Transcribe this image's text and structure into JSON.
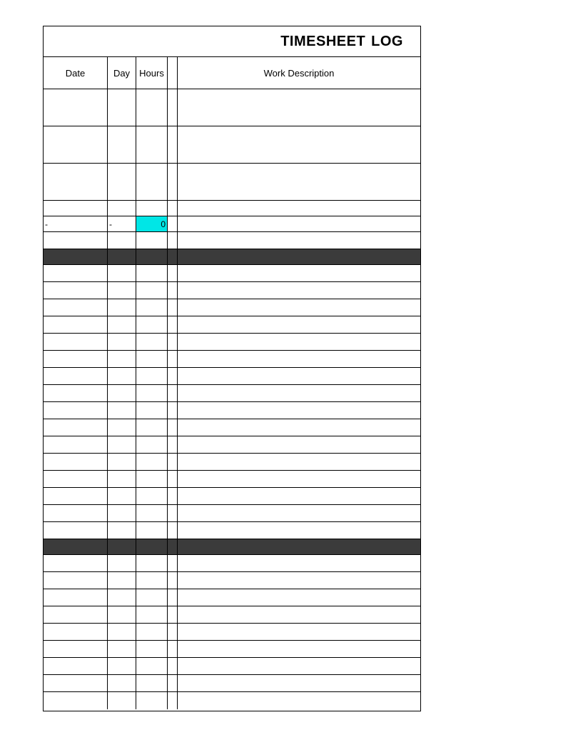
{
  "title": {
    "word1": "TIMESHEET",
    "word2": "LOG"
  },
  "headers": {
    "date": "Date",
    "day": "Day",
    "hours": "Hours",
    "gap": "",
    "desc": "Work Description"
  },
  "section1": {
    "rows": [
      {
        "type": "tall",
        "date": "",
        "day": "",
        "hours": "",
        "desc": ""
      },
      {
        "type": "tall",
        "date": "",
        "day": "",
        "hours": "",
        "desc": ""
      },
      {
        "type": "tall",
        "date": "",
        "day": "",
        "hours": "",
        "desc": ""
      },
      {
        "type": "medium",
        "date": "",
        "day": "",
        "hours": "",
        "desc": ""
      },
      {
        "type": "sum",
        "date": "-",
        "day": "-",
        "hours": "0",
        "desc": "",
        "highlight_hours": true
      },
      {
        "type": "spacer",
        "date": "",
        "day": "",
        "hours": "",
        "desc": ""
      },
      {
        "type": "bar",
        "date": "",
        "day": "",
        "hours": "",
        "desc": ""
      }
    ]
  },
  "section2_row_count": 15,
  "section2_spacer": {
    "type": "spacer"
  },
  "section2_bar": {
    "type": "bar"
  },
  "section3_row_count": 9
}
